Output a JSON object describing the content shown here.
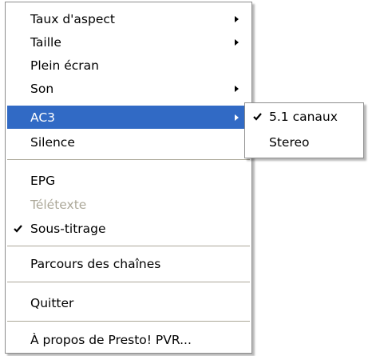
{
  "context_menu": {
    "items": [
      {
        "label": "Taux d'aspect",
        "submenu": true
      },
      {
        "label": "Taille",
        "submenu": true
      },
      {
        "label": "Plein écran"
      },
      {
        "label": "Son",
        "submenu": true
      },
      {
        "label": "AC3",
        "submenu": true,
        "highlighted": true
      },
      {
        "label": "Silence"
      },
      {
        "label": "EPG"
      },
      {
        "label": "Télétexte",
        "disabled": true
      },
      {
        "label": "Sous-titrage",
        "checked": true,
        "icon": "checkmark-icon"
      },
      {
        "label": "Parcours des chaînes"
      },
      {
        "label": "Quitter"
      },
      {
        "label": "À propos de Presto! PVR..."
      }
    ]
  },
  "ac3_submenu": {
    "items": [
      {
        "label": "5.1 canaux",
        "checked": true,
        "icon": "checkmark-icon"
      },
      {
        "label": "Stereo"
      }
    ]
  },
  "colors": {
    "highlight": "#316ac5",
    "highlight_text": "#ffffff",
    "disabled_text": "#aca899",
    "separator": "#aca899",
    "border": "#8d8d8d"
  }
}
